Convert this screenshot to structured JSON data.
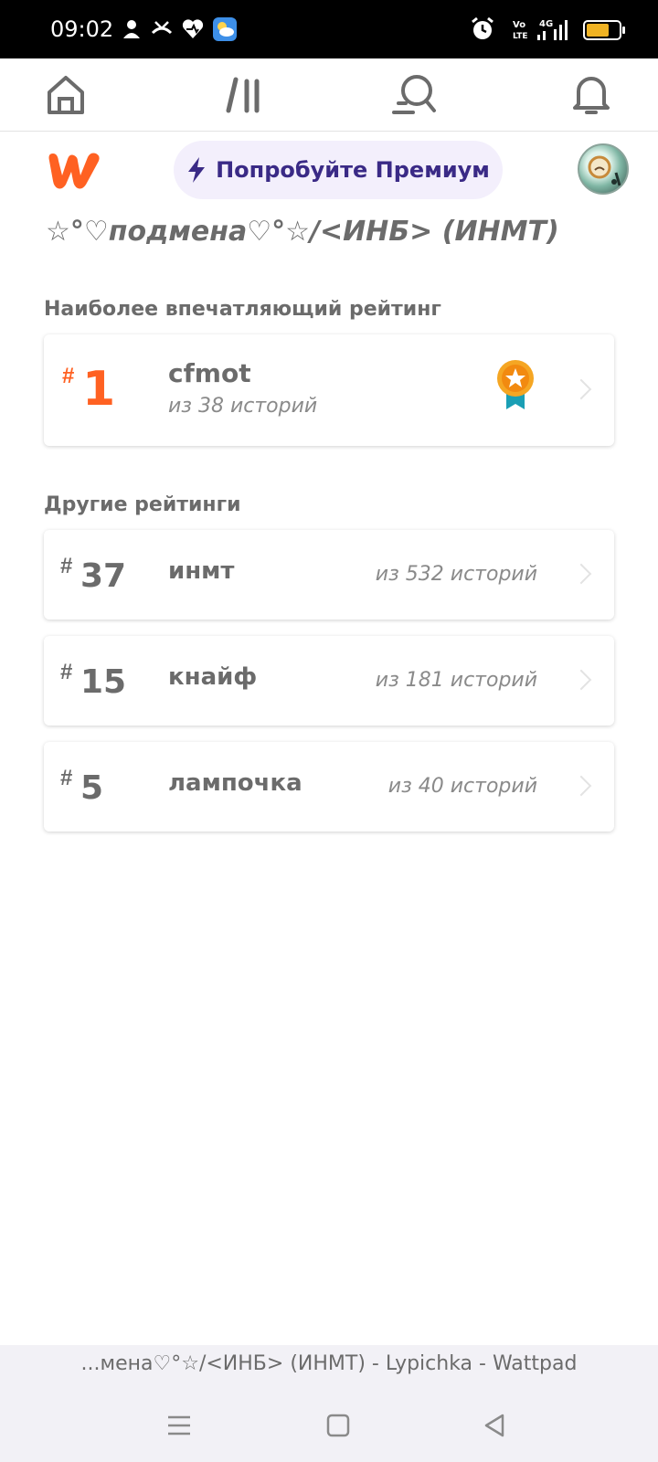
{
  "status_bar": {
    "time": "09:02",
    "battery_level": 0.7,
    "network_label": "4G",
    "volte_label": "Vo LTE"
  },
  "top_nav": {
    "items": [
      {
        "icon": "home-icon"
      },
      {
        "icon": "library-icon"
      },
      {
        "icon": "search-icon"
      },
      {
        "icon": "bell-icon"
      }
    ]
  },
  "header": {
    "premium_label": "Попробуйте Премиум",
    "brand_color": "#ff6122",
    "premium_bg": "#f3effc",
    "premium_text_color": "#3a2a86"
  },
  "story": {
    "title": "☆°♡подмена♡°☆/<ИНБ> (ИНМТ)"
  },
  "top_ranking": {
    "section_label": "Наиболее впечатляющий рейтинг",
    "hash": "#",
    "rank": "1",
    "tag": "cfmot",
    "of_text": "из 38 историй",
    "badge_icon": "award-ribbon-icon"
  },
  "other_rankings": {
    "section_label": "Другие рейтинги",
    "items": [
      {
        "hash": "#",
        "rank": "37",
        "tag": "инмт",
        "of_text": "из 532 историй"
      },
      {
        "hash": "#",
        "rank": "15",
        "tag": "кнайф",
        "of_text": "из 181 историй"
      },
      {
        "hash": "#",
        "rank": "5",
        "tag": "лампочка",
        "of_text": "из 40 историй"
      }
    ]
  },
  "browser": {
    "page_title": "...мена♡°☆/<ИНБ> (ИНМТ) - Lypichka - Wattpad"
  },
  "system_nav": {
    "items": [
      {
        "icon": "recents-icon"
      },
      {
        "icon": "home-square-icon"
      },
      {
        "icon": "back-triangle-icon"
      }
    ]
  }
}
